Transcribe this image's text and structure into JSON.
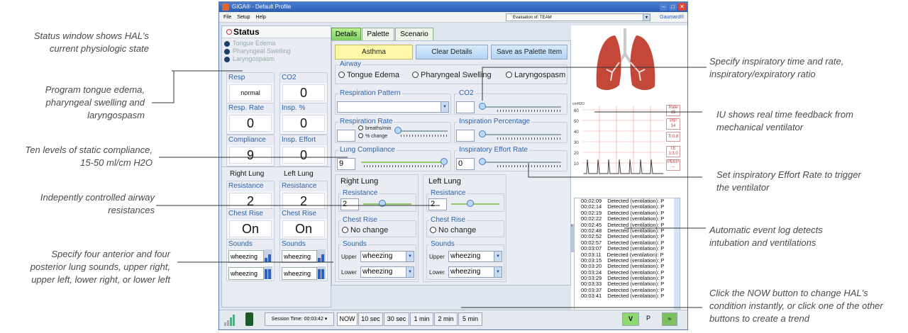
{
  "annotations": {
    "left": [
      "Status window shows HAL's current physiologic state",
      "Program tongue edema, pharyngeal swelling and laryngospasm",
      "Ten levels of static compliance, 15-50 ml/cm H2O",
      "Indepently controlled airway resistances",
      "Specify four anterior and four posterior lung sounds, upper right, upper left, lower right, or lower left"
    ],
    "right": [
      "Specify inspiratory time and rate, inspiratory/expiratory ratio",
      "IU shows real time feedback from mechanical ventilator",
      "Set inspiratory Effort Rate to trigger the ventilator",
      "Automatic event log detects intubation and ventilations",
      "Click the NOW button to change HAL's condition instantly, or click one of the other buttons to create a trend"
    ]
  },
  "window": {
    "title": "GIGA® - Default Profile",
    "menu": [
      "File",
      "Setup",
      "Help"
    ],
    "evaluation": "Evaluation of: TEAM",
    "brand": "Gaumard®"
  },
  "status": {
    "title": "Status",
    "conditions": [
      "Tongue Edema",
      "Pharyngeal Swelling",
      "Laryngospasm"
    ],
    "params": [
      {
        "label": "Resp",
        "value": "normal"
      },
      {
        "label": "CO2",
        "value": "0"
      },
      {
        "label": "Resp. Rate",
        "value": "0"
      },
      {
        "label": "Insp. %",
        "value": "0"
      },
      {
        "label": "Compliance",
        "value": "9"
      },
      {
        "label": "Insp. Effort",
        "value": "0"
      }
    ],
    "right_lung": {
      "header": "Right Lung",
      "resistance_label": "Resistance",
      "resistance": "2",
      "chest_rise_label": "Chest Rise",
      "chest_rise": "On",
      "sounds_label": "Sounds",
      "sounds": [
        "wheezing",
        "wheezing"
      ]
    },
    "left_lung": {
      "header": "Left Lung",
      "resistance_label": "Resistance",
      "resistance": "2",
      "chest_rise_label": "Chest Rise",
      "chest_rise": "On",
      "sounds_label": "Sounds",
      "sounds": [
        "wheezing",
        "wheezing"
      ]
    }
  },
  "tabs": [
    "Details",
    "Palette",
    "Scenario"
  ],
  "details": {
    "asthma": "Asthma",
    "clear": "Clear Details",
    "save": "Save as Palette Item",
    "airway_label": "Airway",
    "airway_options": [
      "Tongue Edema",
      "Pharyngeal Swelling",
      "Laryngospasm"
    ],
    "resp_pattern_label": "Respiration Pattern",
    "co2_label": "CO2",
    "resp_rate_label": "Respiration Rate",
    "rate_units": [
      "breaths/min",
      "% change"
    ],
    "insp_pct_label": "Inspiration Percentage",
    "compliance_label": "Lung Compliance",
    "compliance_value": "9",
    "effort_label": "Inspiratory Effort Rate",
    "effort_value": "0",
    "right_lung": {
      "header": "Right Lung",
      "resistance_label": "Resistance",
      "resistance": "2",
      "chest_rise_label": "Chest Rise",
      "chest_rise": "No change",
      "sounds_label": "Sounds",
      "upper_label": "Upper",
      "upper": "wheezing",
      "lower_label": "Lower",
      "lower": "wheezing"
    },
    "left_lung": {
      "header": "Left Lung",
      "resistance_label": "Resistance",
      "resistance": "2",
      "chest_rise_label": "Chest Rise",
      "chest_rise": "No change",
      "sounds_label": "Sounds",
      "upper_label": "Upper",
      "upper": "wheezing",
      "lower_label": "Lower",
      "lower": "wheezing"
    }
  },
  "ventilator": {
    "unit": "cmH2O",
    "yticks": [
      "60",
      "50",
      "40",
      "30",
      "20",
      "10"
    ],
    "readouts": [
      {
        "label": "Rate",
        "value": "15"
      },
      {
        "label": "PIP",
        "value": "14"
      },
      {
        "label": "Ti:0.8",
        "value": ""
      },
      {
        "label": "I:E",
        "value": "1:3.0"
      },
      {
        "label": "PEEP",
        "value": "--"
      }
    ]
  },
  "log": {
    "times": [
      "00:02:09",
      "00:02:14",
      "00:02:19",
      "00:02:22",
      "00:02:45",
      "00:02:48",
      "00:02:52",
      "00:02:57",
      "00:03:07",
      "00:03:11",
      "00:03:15",
      "00:03:20",
      "00:03:24",
      "00:03:29",
      "00:03:33",
      "00:03:37",
      "00:03:41"
    ],
    "event": "Detected (ventilation): P"
  },
  "bottom": {
    "session": "Session Time: 00:03:42",
    "trend": [
      "NOW",
      "10 sec",
      "30 sec",
      "1 min",
      "2 min",
      "5 min"
    ],
    "v": "V",
    "p": "P"
  },
  "colors": {
    "accent_green": "#7fd060",
    "tab_blue": "#2e62a8",
    "vent_trace": "#333333"
  }
}
